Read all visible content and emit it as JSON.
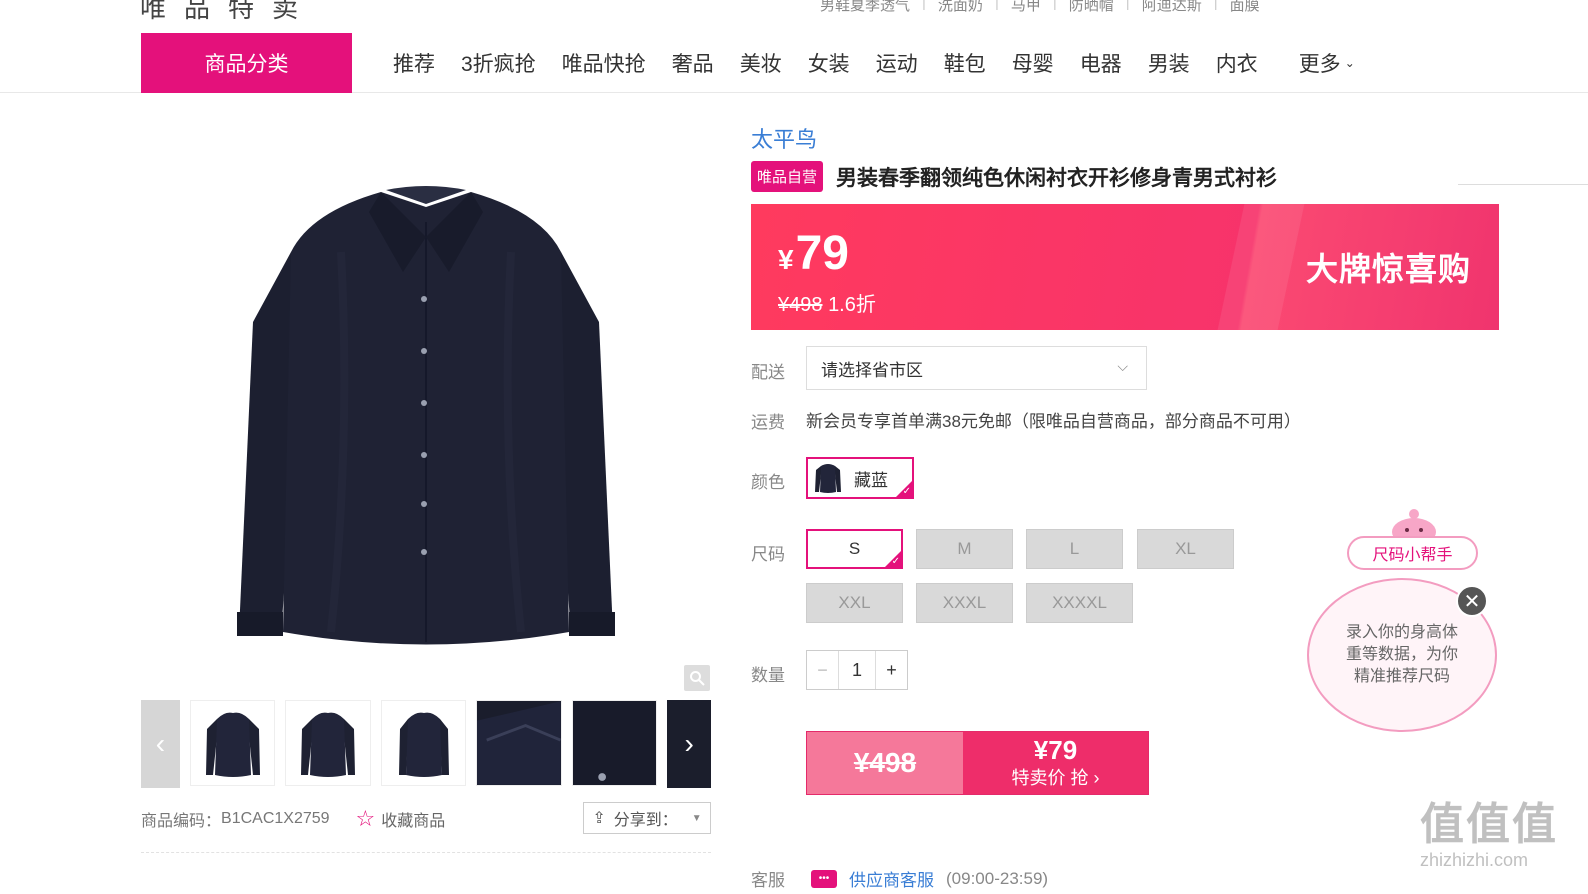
{
  "header": {
    "logo_partial": "唯品特卖",
    "hot_links": [
      "男鞋夏季透气",
      "洗面奶",
      "马甲",
      "防晒帽",
      "阿迪达斯",
      "面膜"
    ]
  },
  "nav": {
    "category_button": "商品分类",
    "items": [
      "推荐",
      "3折疯抢",
      "唯品快抢",
      "奢品",
      "美妆",
      "女装",
      "运动",
      "鞋包",
      "母婴",
      "电器",
      "男装",
      "内衣"
    ],
    "more": "更多"
  },
  "gallery": {
    "product_code_label": "商品编码：",
    "product_code": "B1CAC1X2759",
    "favorite_label": "收藏商品",
    "share_label": "分享到："
  },
  "product": {
    "brand": "太平鸟",
    "self_tag": "唯品自营",
    "title": "男装春季翻领纯色休闲衬衣开衫修身青男式衬衫"
  },
  "price": {
    "currency": "¥",
    "current": "79",
    "original": "¥498",
    "discount": "1.6折",
    "promo": "大牌惊喜购"
  },
  "options": {
    "delivery_label": "配送",
    "delivery_placeholder": "请选择省市区",
    "shipping_label": "运费",
    "shipping_text": "新会员专享首单满38元免邮（限唯品自营商品，部分商品不可用）",
    "color_label": "颜色",
    "color_value": "藏蓝",
    "size_label": "尺码",
    "sizes": [
      "S",
      "M",
      "L",
      "XL",
      "XXL",
      "XXXL",
      "XXXXL"
    ],
    "selected_size": "S",
    "qty_label": "数量",
    "qty": "1",
    "qty_minus": "−",
    "qty_plus": "+"
  },
  "buy": {
    "old_price": "¥498",
    "new_price": "¥79",
    "action": "特卖价 抢 ›"
  },
  "service": {
    "label": "客服",
    "link": "供应商客服",
    "hours": "(09:00-23:59)"
  },
  "helper": {
    "title": "尺码小帮手",
    "text": "录入你的身高体重等数据，为你精准推荐尺码"
  },
  "watermark": {
    "big": "值值值",
    "small": "zhizhizhi.com"
  },
  "colors": {
    "accent": "#e4117b",
    "price_red": "#f7336b",
    "brand_blue": "#3a7ed5",
    "shirt_navy": "#1b1e2e"
  }
}
